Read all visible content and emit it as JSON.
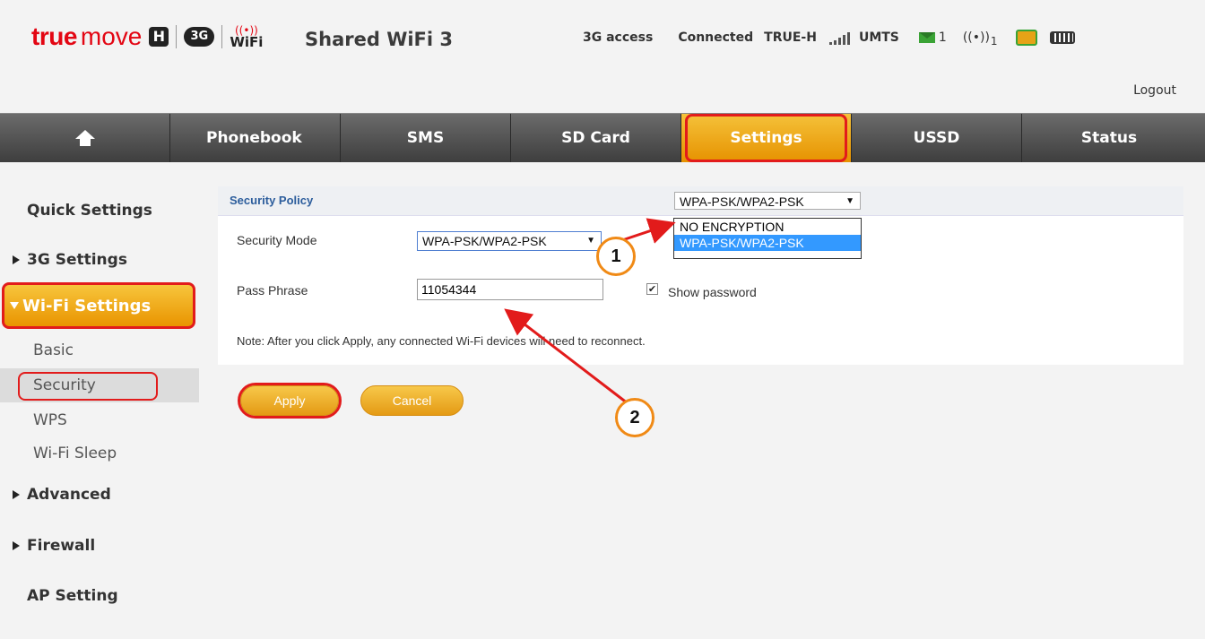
{
  "header": {
    "brand_true": "true",
    "brand_move": "move",
    "brand_h": "H",
    "brand_3g": "3G",
    "brand_wifi": "WiFi",
    "product": "Shared WiFi 3",
    "access": "3G access",
    "connection": "Connected",
    "carrier": "TRUE-H",
    "network": "UMTS",
    "sms_count": "1",
    "wifi_clients": "1",
    "logout": "Logout"
  },
  "nav": {
    "items": [
      "Phonebook",
      "SMS",
      "SD Card",
      "Settings",
      "USSD",
      "Status"
    ],
    "active": "Settings"
  },
  "sidebar": {
    "quick": "Quick Settings",
    "g3": "3G Settings",
    "wifi": "Wi-Fi Settings",
    "sub": [
      "Basic",
      "Security",
      "WPS",
      "Wi-Fi Sleep"
    ],
    "advanced": "Advanced",
    "firewall": "Firewall",
    "ap": "AP Setting"
  },
  "panel": {
    "title": "Security Policy",
    "security_mode_label": "Security Mode",
    "security_mode_value": "WPA-PSK/WPA2-PSK",
    "pass_label": "Pass Phrase",
    "pass_value": "11054344",
    "show_password": "Show password",
    "show_password_checked": true,
    "note": "Note: After you click Apply, any connected Wi-Fi devices will need to reconnect.",
    "dropdown_value": "WPA-PSK/WPA2-PSK",
    "dropdown_options": [
      "NO ENCRYPTION",
      "WPA-PSK/WPA2-PSK"
    ],
    "dropdown_highlighted": "WPA-PSK/WPA2-PSK"
  },
  "buttons": {
    "apply": "Apply",
    "cancel": "Cancel"
  },
  "annotations": {
    "one": "1",
    "two": "2"
  },
  "colors": {
    "accent_orange": "#f0a51e",
    "highlight_red": "#e21b1b",
    "nav_dark": "#4a4a4a",
    "link_blue": "#2c5d9c"
  }
}
